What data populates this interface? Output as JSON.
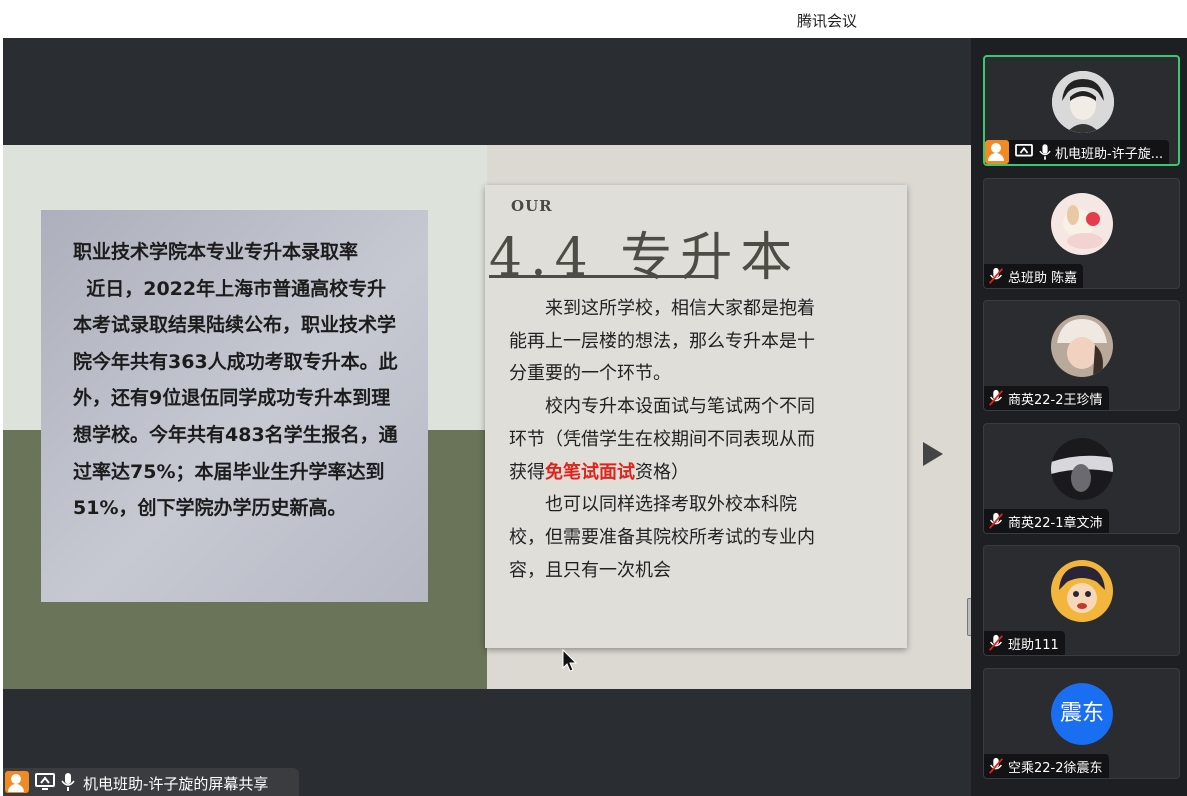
{
  "window": {
    "title": "腾讯会议"
  },
  "slide": {
    "left_text": "职业技术学院本专业专升本录取率\n  近日，2022年上海市普通高校专升本考试录取结果陆续公布，职业技术学院今年共有363人成功考取专升本。此外，还有9位退伍同学成功专升本到理想学校。今年共有483名学生报名，通过率达75%；本届毕业生升学率达到51%，创下学院办学历史新高。",
    "our": "OUR",
    "heading": "4.4 专升本",
    "p1": "来到这所学校，相信大家都是抱着能再上一层楼的想法，那么专升本是十分重要的一个环节。",
    "p2_before": "校内专升本设面试与笔试两个不同环节（凭借学生在校期间不同表现从而获得",
    "p2_red": "免笔试面试",
    "p2_after": "资格）",
    "p3": "也可以同样选择考取外校本科院校，但需要准备其院校所考试的专业内容，且只有一次机会"
  },
  "share_bar": {
    "label": "机电班助-许子旋的屏幕共享"
  },
  "participants": [
    {
      "name": "机电班助-许子旋...",
      "mic": "on",
      "avatar": "anime-boy-avatar",
      "active": true
    },
    {
      "name": "总班助 陈嘉",
      "mic": "muted",
      "avatar": "cartoon-dog-avatar"
    },
    {
      "name": "商英22-2王珍情",
      "mic": "muted",
      "avatar": "girl-photo-avatar"
    },
    {
      "name": "商英22-1章文沛",
      "mic": "muted",
      "avatar": "dark-photo-avatar"
    },
    {
      "name": "班助111",
      "mic": "muted",
      "avatar": "detective-anime-avatar"
    },
    {
      "name": "空乘22-2徐震东",
      "mic": "muted",
      "avatar_text": "震东",
      "avatar_color": "#1a6ef2"
    }
  ],
  "colors": {
    "accent_green": "#37c871",
    "highlight_red": "#e2231a",
    "host_orange": "#f08a24"
  }
}
